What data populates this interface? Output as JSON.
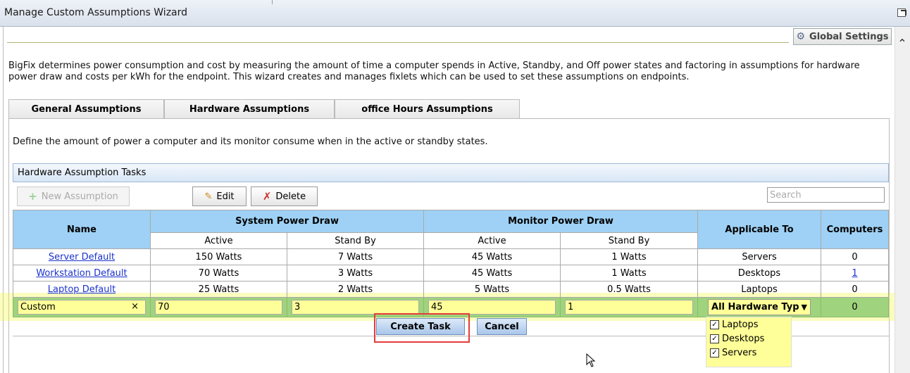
{
  "window": {
    "title": "Manage Custom Assumptions Wizard",
    "global_settings": "Global Settings"
  },
  "intro": "BigFix determines power consumption and cost by measuring the amount of time a computer spends in Active, Standby, and Off power states and factoring in assumptions for hardware power draw and costs per kWh for the endpoint. This wizard creates and manages fixlets which can be used to set these assumptions on endpoints.",
  "tabs": [
    "General Assumptions",
    "Hardware Assumptions",
    "office Hours Assumptions"
  ],
  "description": "Define the amount of power a computer and its monitor consume when in the active or standby states.",
  "tasks_header": "Hardware Assumption Tasks",
  "toolbar": {
    "new": "New Assumption",
    "edit": "Edit",
    "delete": "Delete",
    "search_placeholder": "Search"
  },
  "table": {
    "headers": {
      "name": "Name",
      "system": "System Power Draw",
      "monitor": "Monitor Power Draw",
      "applicable": "Applicable To",
      "computers": "Computers",
      "active": "Active",
      "standby": "Stand By"
    },
    "rows": [
      {
        "name": "Server Default",
        "sys_active": "150 Watts",
        "sys_standby": "7 Watts",
        "mon_active": "45 Watts",
        "mon_standby": "1 Watts",
        "applicable": "Servers",
        "computers": "0"
      },
      {
        "name": "Workstation Default",
        "sys_active": "70 Watts",
        "sys_standby": "3 Watts",
        "mon_active": "45 Watts",
        "mon_standby": "1 Watts",
        "applicable": "Desktops",
        "computers": "1"
      },
      {
        "name": "Laptop Default",
        "sys_active": "25 Watts",
        "sys_standby": "2 Watts",
        "mon_active": "5 Watts",
        "mon_standby": "0.5 Watts",
        "applicable": "Laptops",
        "computers": "0"
      }
    ],
    "edit_row": {
      "name": "Custom",
      "sys_active": "70",
      "sys_standby": "3",
      "mon_active": "45",
      "mon_standby": "1",
      "applicable": "All Hardware Typ",
      "computers": "0"
    }
  },
  "actions": {
    "create": "Create Task",
    "cancel": "Cancel"
  },
  "dropdown_options": [
    "Laptops",
    "Desktops",
    "Servers"
  ],
  "colors": {
    "header_blue": "#9ed1f5",
    "edit_green": "#9fd37d",
    "input_yellow": "#ffff99",
    "highlight_red": "#e63b3b"
  }
}
